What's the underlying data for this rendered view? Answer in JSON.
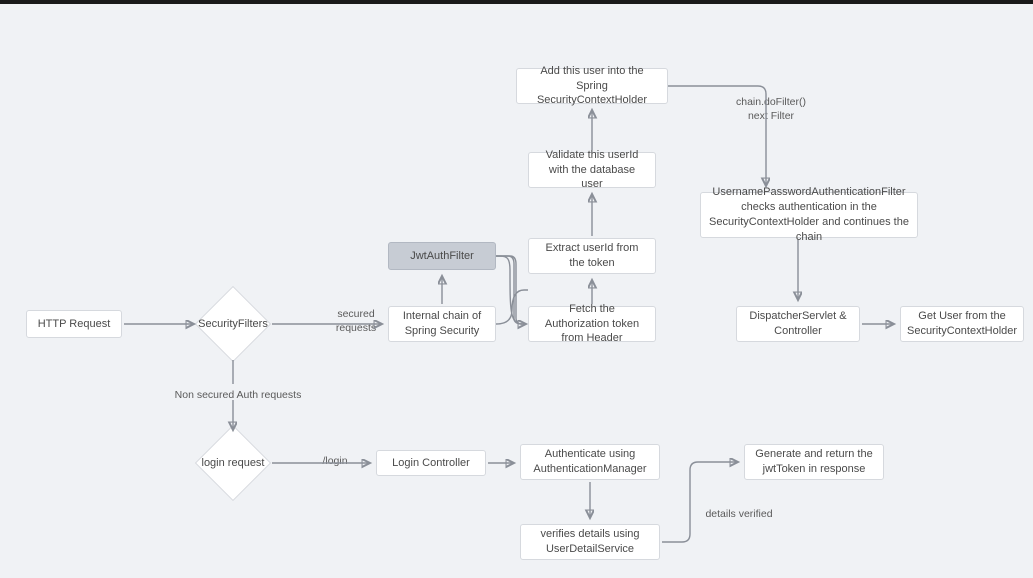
{
  "nodes": {
    "http_request": "HTTP Request",
    "security_filters": "SecurityFilters",
    "internal_chain": "Internal chain of Spring Security",
    "jwt_auth_filter": "JwtAuthFilter",
    "fetch_auth": "Fetch the Authorization token from Header",
    "extract_userid": "Extract userId from the token",
    "validate_userid": "Validate this userId with the database user",
    "add_user": "Add this user into the Spring SecurityContextHolder",
    "upaf": "UsernamePasswordAuthenticationFilter checks authentication in the SecurityContextHolder and continues the chain",
    "dispatcher": "DispatcherServlet & Controller",
    "get_user": "Get User from the SecurityContextHolder",
    "login_request": "login request",
    "login_controller": "Login Controller",
    "auth_manager": "Authenticate using AuthenticationManager",
    "verify_details": "verifies details using UserDetailService",
    "gen_jwt": "Generate and return the jwtToken in response"
  },
  "edges": {
    "secured_requests": "secured requests",
    "non_secured": "Non secured Auth requests",
    "login_path": "/login",
    "details_verified": "details verified",
    "chain_dofilter": "chain.doFilter() next Filter"
  }
}
